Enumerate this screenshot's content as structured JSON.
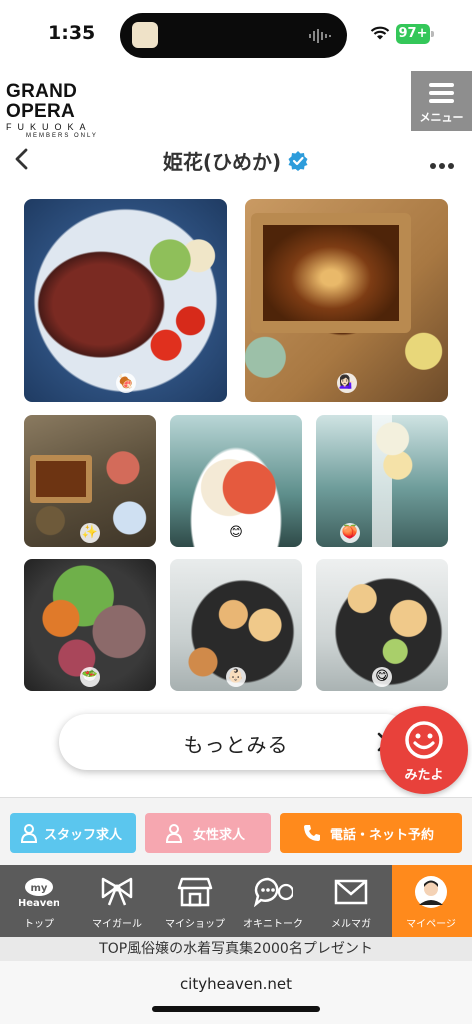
{
  "status": {
    "time": "1:35",
    "battery": "97+"
  },
  "header": {
    "logo_line1": "GRAND OPERA",
    "logo_line2": "FUKUOKA",
    "logo_line3": "MEMBERS ONLY",
    "menu_label": "メニュー"
  },
  "profile": {
    "title": "姫花(ひめか)"
  },
  "photos": [
    {
      "emoji": "🍖"
    },
    {
      "emoji": "💁🏻‍♀️"
    },
    {
      "emoji": "✨"
    },
    {
      "emoji": "😊"
    },
    {
      "emoji": "🍑"
    },
    {
      "emoji": "🥗"
    },
    {
      "emoji": "👶🏻"
    },
    {
      "emoji": "😋"
    }
  ],
  "more_button": {
    "label": "もっとみる"
  },
  "mitayo": {
    "label": "みたよ"
  },
  "actions": {
    "staff": "スタッフ求人",
    "women": "女性求人",
    "phone": "電話・ネット予約"
  },
  "nav": {
    "items": [
      {
        "label": "トップ",
        "icon": "my-heaven-icon",
        "badge": "my",
        "badge2": "Heaven"
      },
      {
        "label": "マイガール",
        "icon": "ribbon-icon"
      },
      {
        "label": "マイショップ",
        "icon": "shop-icon"
      },
      {
        "label": "オキニトーク",
        "icon": "chat-icon"
      },
      {
        "label": "メルマガ",
        "icon": "mail-icon"
      },
      {
        "label": "マイページ",
        "icon": "avatar-icon"
      }
    ]
  },
  "promo": "TOP風俗嬢の水着写真集2000名プレゼント",
  "browser": {
    "url": "cityheaven.net"
  },
  "colors": {
    "orange": "#ff8a1c",
    "blue": "#5bc6ee",
    "pink": "#f6a7b0",
    "red": "#e8413b",
    "nav": "#5b5b5b"
  }
}
